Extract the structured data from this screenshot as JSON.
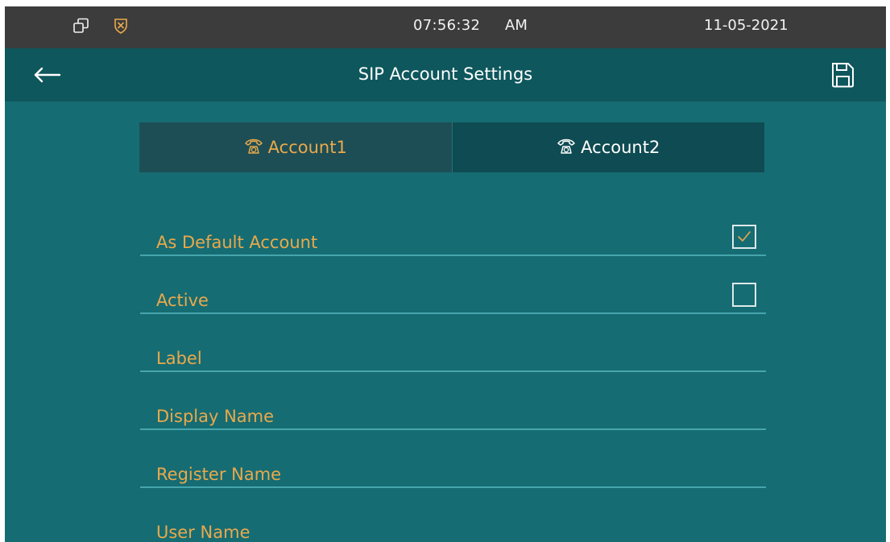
{
  "status": {
    "time": "07:56:32",
    "ampm": "AM",
    "date": "11-05-2021",
    "icons": [
      "window-icon",
      "shield-icon"
    ]
  },
  "header": {
    "title": "SIP Account Settings",
    "back_icon": "arrow-left-icon",
    "save_icon": "save-icon"
  },
  "tabs": [
    {
      "label": "Account1",
      "icon": "phone-icon",
      "active": true
    },
    {
      "label": "Account2",
      "icon": "phone-icon",
      "active": false
    }
  ],
  "fields": [
    {
      "label": "As Default Account",
      "checkbox": true,
      "checked": true
    },
    {
      "label": "Active",
      "checkbox": true,
      "checked": false
    },
    {
      "label": "Label"
    },
    {
      "label": "Display Name"
    },
    {
      "label": "Register Name"
    },
    {
      "label": "User Name"
    }
  ],
  "colors": {
    "accent": "#e9a94b",
    "background": "#166c73",
    "titlebar": "#0e575c",
    "statusbar": "#3c3c3c"
  }
}
